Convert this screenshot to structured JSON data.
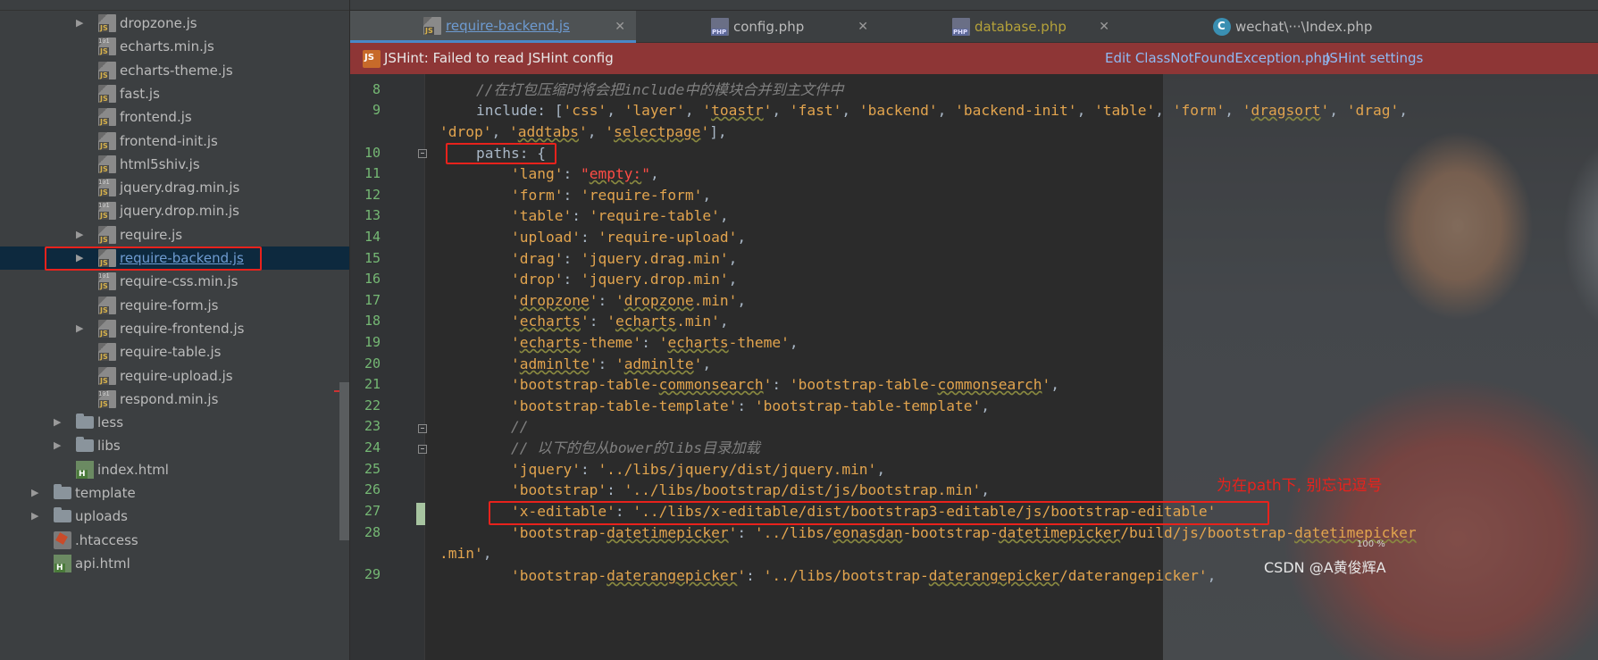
{
  "tree": {
    "items": [
      {
        "label": "dropzone.js",
        "icon": "js-file-icon",
        "arrow": true
      },
      {
        "label": "echarts.min.js",
        "icon": "min-js-file-icon"
      },
      {
        "label": "echarts-theme.js",
        "icon": "js-file-icon"
      },
      {
        "label": "fast.js",
        "icon": "js-file-icon"
      },
      {
        "label": "frontend.js",
        "icon": "js-file-icon"
      },
      {
        "label": "frontend-init.js",
        "icon": "js-file-icon"
      },
      {
        "label": "html5shiv.js",
        "icon": "js-file-icon"
      },
      {
        "label": "jquery.drag.min.js",
        "icon": "min-js-file-icon"
      },
      {
        "label": "jquery.drop.min.js",
        "icon": "min-js-file-icon"
      },
      {
        "label": "require.js",
        "icon": "js-file-icon",
        "arrow": true
      },
      {
        "label": "require-backend.js",
        "icon": "js-file-icon",
        "arrow": true,
        "selected": true
      },
      {
        "label": "require-css.min.js",
        "icon": "min-js-file-icon"
      },
      {
        "label": "require-form.js",
        "icon": "js-file-icon"
      },
      {
        "label": "require-frontend.js",
        "icon": "js-file-icon",
        "arrow": true
      },
      {
        "label": "require-table.js",
        "icon": "js-file-icon"
      },
      {
        "label": "require-upload.js",
        "icon": "js-file-icon"
      },
      {
        "label": "respond.min.js",
        "icon": "min-js-file-icon"
      },
      {
        "label": "less",
        "icon": "folder-icon",
        "arrow": true
      },
      {
        "label": "libs",
        "icon": "folder-icon",
        "arrow": true
      },
      {
        "label": "index.html",
        "icon": "html-file-icon"
      },
      {
        "label": "template",
        "icon": "folder-icon",
        "arrow": true
      },
      {
        "label": "uploads",
        "icon": "folder-icon",
        "arrow": true
      },
      {
        "label": ".htaccess",
        "icon": "htaccess-file-icon"
      },
      {
        "label": "api.html",
        "icon": "html-file-icon"
      }
    ]
  },
  "tabs": [
    {
      "label": "require-backend.js",
      "icon": "js-file-icon",
      "active": true
    },
    {
      "label": "config.php",
      "icon": "php-file-icon"
    },
    {
      "label": "database.php",
      "icon": "php-file-icon",
      "color": "#b5a23a"
    },
    {
      "label": "wechat\\···\\Index.php",
      "icon": "class-icon"
    }
  ],
  "jshint": {
    "message": "JSHint: Failed to read JSHint config",
    "link1": "Edit ClassNotFoundException.php",
    "link2": "JSHint settings"
  },
  "code": {
    "lines": [
      {
        "n": "8"
      },
      {
        "n": "9"
      },
      {
        "n": ""
      },
      {
        "n": "10"
      },
      {
        "n": "11"
      },
      {
        "n": "12"
      },
      {
        "n": "13"
      },
      {
        "n": "14"
      },
      {
        "n": "15"
      },
      {
        "n": "16"
      },
      {
        "n": "17"
      },
      {
        "n": "18"
      },
      {
        "n": "19"
      },
      {
        "n": "20"
      },
      {
        "n": "21"
      },
      {
        "n": "22"
      },
      {
        "n": "23"
      },
      {
        "n": "24"
      },
      {
        "n": "25"
      },
      {
        "n": "26"
      },
      {
        "n": "27"
      },
      {
        "n": "28"
      },
      {
        "n": ""
      },
      {
        "n": "29"
      }
    ]
  },
  "annotation": "为在path下, 别忘记逗号",
  "watermark": "CSDN @A黄俊辉A",
  "zoom": "100 %",
  "colors": {
    "highlight": "#e8221c",
    "accent": "#4a88c7",
    "error_bar": "#8e3636"
  }
}
